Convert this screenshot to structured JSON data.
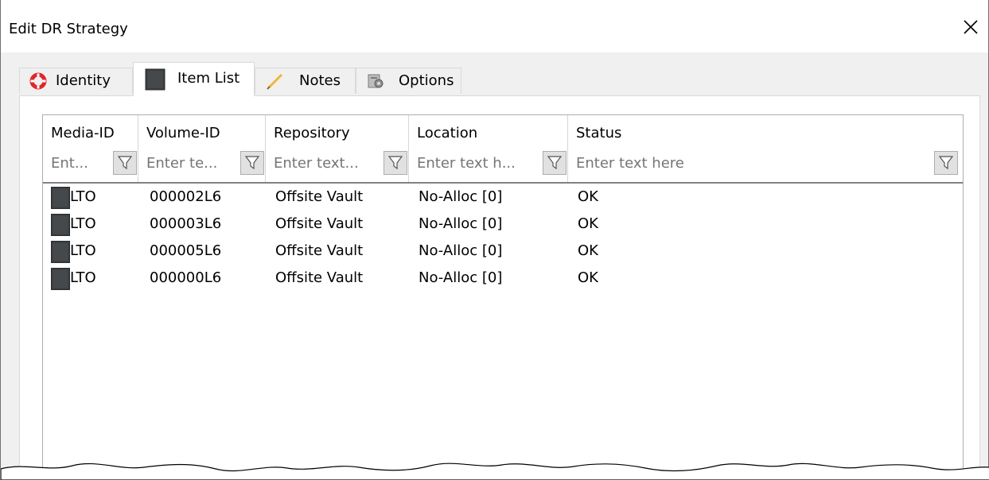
{
  "window": {
    "title": "Edit DR Strategy",
    "close_glyph": "✕"
  },
  "tabs": [
    {
      "label": "Identity",
      "icon": "lifebuoy-icon",
      "active": false
    },
    {
      "label": "Item List",
      "icon": "tape-cartridge-icon",
      "active": true
    },
    {
      "label": "Notes",
      "icon": "pencil-icon",
      "active": false
    },
    {
      "label": "Options",
      "icon": "options-icon",
      "active": false
    }
  ],
  "table": {
    "columns": [
      {
        "label": "Media-ID",
        "filter_placeholder": "Ent..."
      },
      {
        "label": "Volume-ID",
        "filter_placeholder": "Enter te..."
      },
      {
        "label": "Repository",
        "filter_placeholder": "Enter text..."
      },
      {
        "label": "Location",
        "filter_placeholder": "Enter text h..."
      },
      {
        "label": "Status",
        "filter_placeholder": "Enter text here"
      }
    ],
    "rows": [
      {
        "media_id": "LTO",
        "volume_id": "000002L6",
        "repository": "Offsite Vault",
        "location": "No-Alloc [0]",
        "status": "OK"
      },
      {
        "media_id": "LTO",
        "volume_id": "000003L6",
        "repository": "Offsite Vault",
        "location": "No-Alloc [0]",
        "status": "OK"
      },
      {
        "media_id": "LTO",
        "volume_id": "000005L6",
        "repository": "Offsite Vault",
        "location": "No-Alloc [0]",
        "status": "OK"
      },
      {
        "media_id": "LTO",
        "volume_id": "000000L6",
        "repository": "Offsite Vault",
        "location": "No-Alloc [0]",
        "status": "OK"
      }
    ]
  },
  "colors": {
    "window_bg": "#f0f0f0",
    "panel_bg": "#ffffff",
    "lifebuoy_red": "#e0262b",
    "tape_dark": "#3a3d40"
  }
}
